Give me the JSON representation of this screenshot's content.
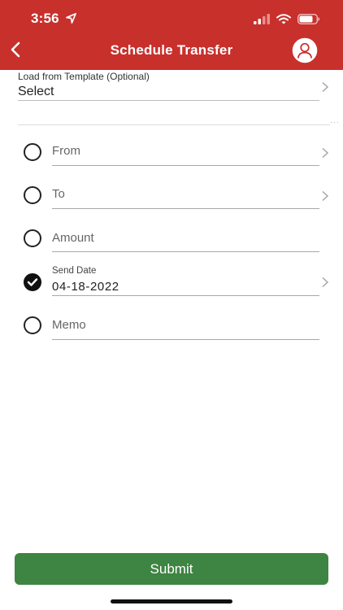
{
  "status": {
    "time": "3:56"
  },
  "header": {
    "title": "Schedule Transfer"
  },
  "template": {
    "label": "Load from Template (Optional)",
    "value": "Select"
  },
  "fields": {
    "from": {
      "label": "From",
      "checked": false
    },
    "to": {
      "label": "To",
      "checked": false
    },
    "amount": {
      "label": "Amount",
      "checked": false
    },
    "send_date": {
      "label": "Send Date",
      "value": "04-18-2022",
      "checked": true
    },
    "memo": {
      "label": "Memo",
      "checked": false
    }
  },
  "footer": {
    "submit_label": "Submit"
  },
  "colors": {
    "header": "#c8302c",
    "submit": "#3e8442"
  },
  "icons": {
    "back": "chevron-left-icon",
    "profile": "user-circle-icon",
    "row_chevron": "chevron-right-icon",
    "location": "location-arrow-icon",
    "signal": "signal-icon",
    "wifi": "wifi-icon",
    "battery": "battery-icon"
  }
}
